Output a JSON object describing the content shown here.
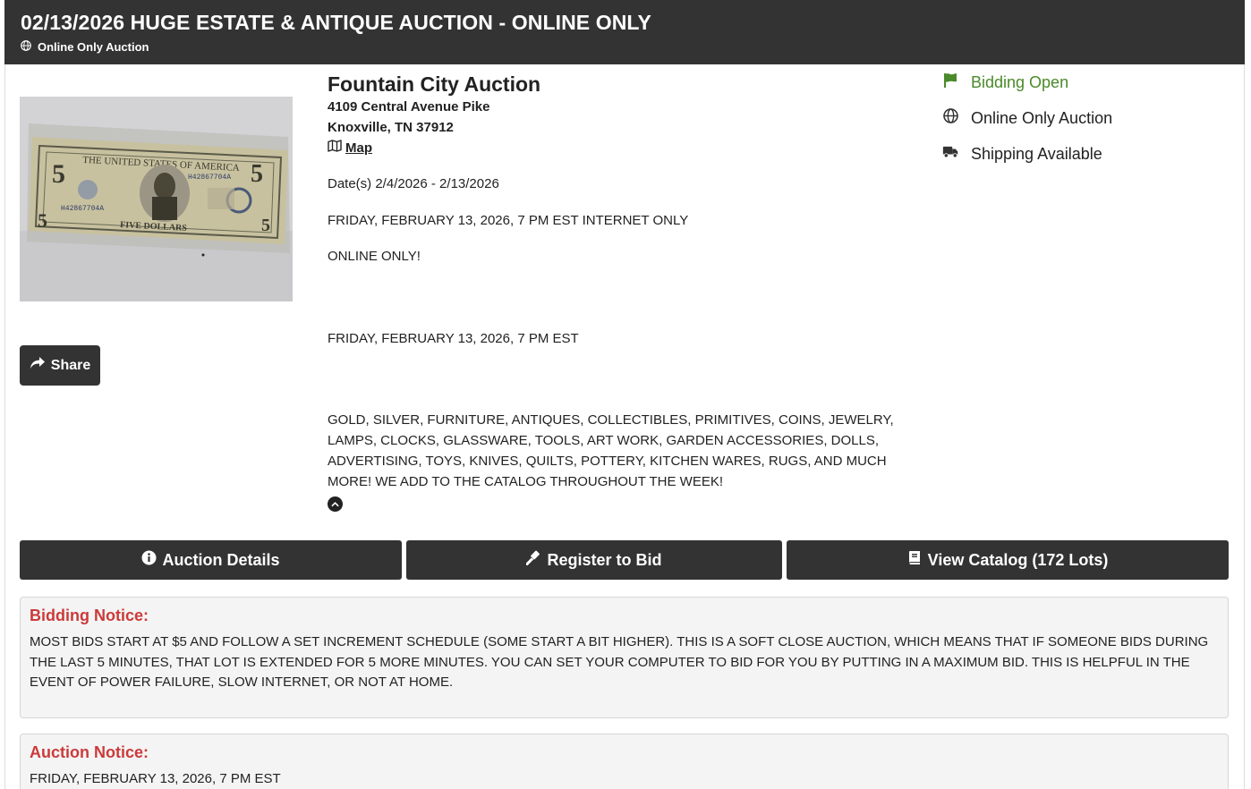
{
  "header": {
    "title": "02/13/2026 HUGE ESTATE & ANTIQUE AUCTION - ONLINE ONLY",
    "subtitle": "Online Only Auction",
    "subtitle_icon": "globe-icon"
  },
  "image": {
    "description_icon": "five-dollar-bill-photo"
  },
  "share": {
    "label": "Share",
    "icon": "share-icon"
  },
  "auctioneer": {
    "name": "Fountain City Auction",
    "street": "4109 Central Avenue Pike",
    "city": "Knoxville, TN 37912",
    "map_label": "Map",
    "map_icon": "map-icon"
  },
  "details": {
    "dates": "Date(s) 2/4/2026 - 2/13/2026",
    "line1": "FRIDAY, FEBRUARY 13, 2026, 7 PM EST INTERNET ONLY",
    "line2": "ONLINE ONLY!",
    "line3": "FRIDAY, FEBRUARY 13, 2026, 7 PM EST",
    "description": "GOLD, SILVER, FURNITURE, ANTIQUES, COLLECTIBLES, PRIMITIVES, COINS, JEWELRY, LAMPS, CLOCKS, GLASSWARE, TOOLS, ART WORK, GARDEN ACCESSORIES, DOLLS, ADVERTISING, TOYS, KNIVES, QUILTS, POTTERY, KITCHEN WARES, RUGS, AND MUCH MORE! WE ADD TO THE CATALOG THROUGHOUT THE WEEK!"
  },
  "status": {
    "bidding": "Bidding Open",
    "type": "Online Only Auction",
    "shipping": "Shipping Available",
    "bidding_color": "#4a8a2a"
  },
  "actions": {
    "details": "Auction Details",
    "register": "Register to Bid",
    "catalog": "View Catalog (172 Lots)"
  },
  "notices": {
    "bidding_title": "Bidding Notice:",
    "bidding_body": "MOST BIDS START AT $5 AND FOLLOW A SET INCREMENT SCHEDULE (SOME START A BIT HIGHER). THIS IS A SOFT CLOSE AUCTION, WHICH MEANS THAT IF SOMEONE BIDS DURING THE LAST 5 MINUTES, THAT LOT IS EXTENDED FOR 5 MORE MINUTES. YOU CAN SET YOUR COMPUTER TO BID FOR YOU BY PUTTING IN A MAXIMUM BID. THIS IS HELPFUL IN THE EVENT OF POWER FAILURE, SLOW INTERNET, OR NOT AT HOME.",
    "auction_title": "Auction Notice:",
    "auction_body": "FRIDAY, FEBRUARY 13, 2026, 7 PM EST"
  },
  "colors": {
    "header_bg": "#333333",
    "notice_title": "#cc3a3a",
    "button_bg": "#333333"
  }
}
